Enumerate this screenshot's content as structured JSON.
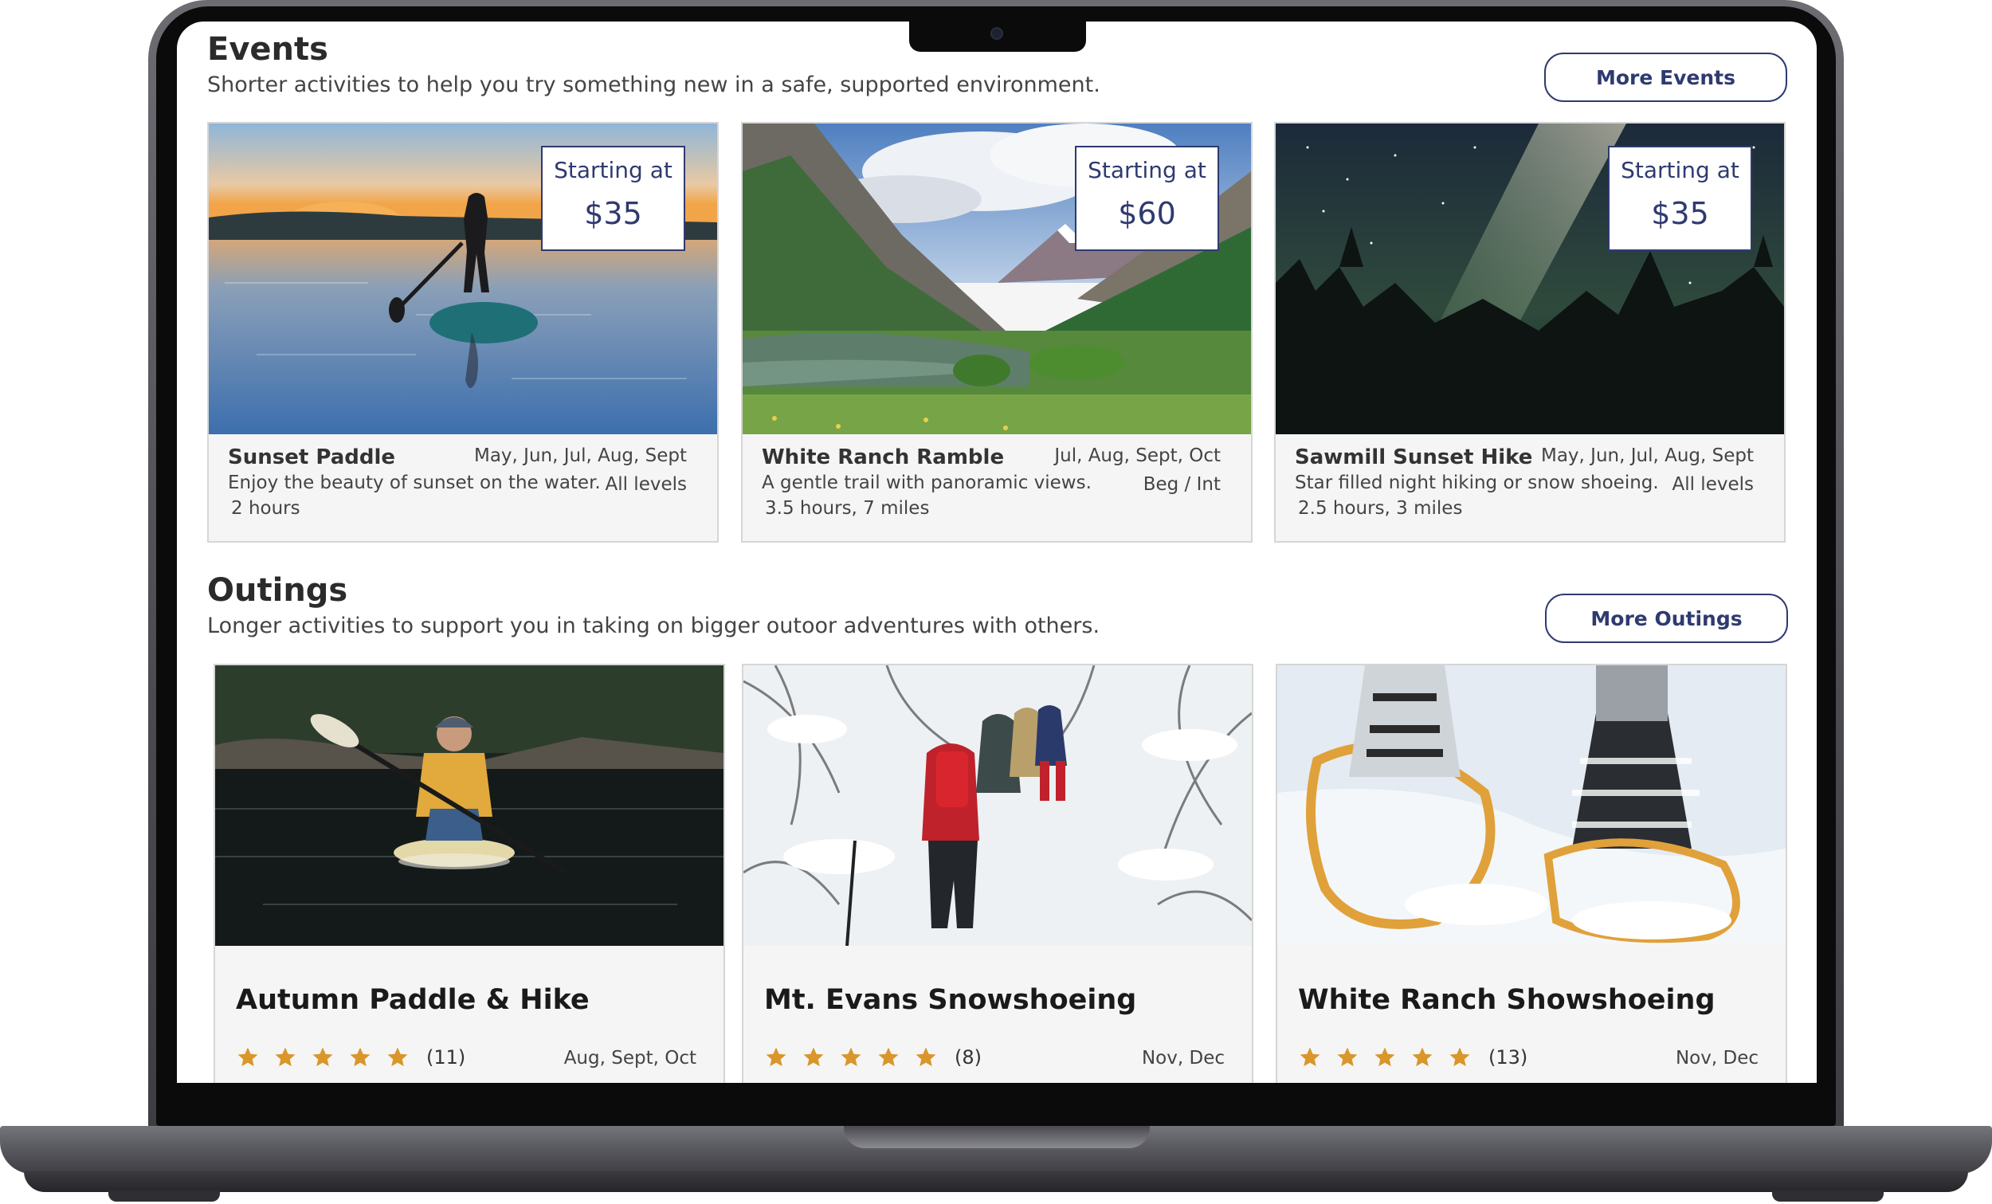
{
  "events": {
    "title": "Events",
    "subtitle": "Shorter activities to help you try something new in a safe, supported environment.",
    "more_button": "More Events",
    "cards": [
      {
        "name": "Sunset Paddle",
        "months": "May, Jun, Jul, Aug, Sept",
        "description": "Enjoy the beauty of sunset on the water.",
        "level": "All levels",
        "duration": "2 hours",
        "price_label": "Starting at",
        "price": "$35",
        "image": "paddleboard-sunset"
      },
      {
        "name": "White Ranch Ramble",
        "months": "Jul, Aug, Sept, Oct",
        "description": "A gentle trail with panoramic views.",
        "level": "Beg / Int",
        "duration": "3.5 hours, 7 miles",
        "price_label": "Starting at",
        "price": "$60",
        "image": "mountain-lake-valley"
      },
      {
        "name": "Sawmill Sunset Hike",
        "months": "May, Jun, Jul, Aug, Sept",
        "description": "Star filled night hiking or snow shoeing.",
        "level": "All levels",
        "duration": "2.5 hours, 3 miles",
        "price_label": "Starting at",
        "price": "$35",
        "image": "milky-way-forest"
      }
    ]
  },
  "outings": {
    "title": "Outings",
    "subtitle": "Longer activities to support you in taking on bigger outoor adventures with others.",
    "more_button": "More Outings",
    "cards": [
      {
        "name": "Autumn Paddle & Hike",
        "rating_count": "(11)",
        "stars": 5,
        "months": "Aug, Sept, Oct",
        "image": "kayaker-on-lake"
      },
      {
        "name": "Mt. Evans Snowshoeing",
        "rating_count": "(8)",
        "stars": 5,
        "months": "Nov, Dec",
        "image": "snowy-forest-hikers"
      },
      {
        "name": "White Ranch Showshoeing",
        "rating_count": "(13)",
        "stars": 5,
        "months": "Nov, Dec",
        "image": "snowshoes-closeup"
      }
    ]
  },
  "colors": {
    "accent_navy": "#2f3a70",
    "star_gold": "#d9962a",
    "card_bg": "#f5f5f5"
  }
}
